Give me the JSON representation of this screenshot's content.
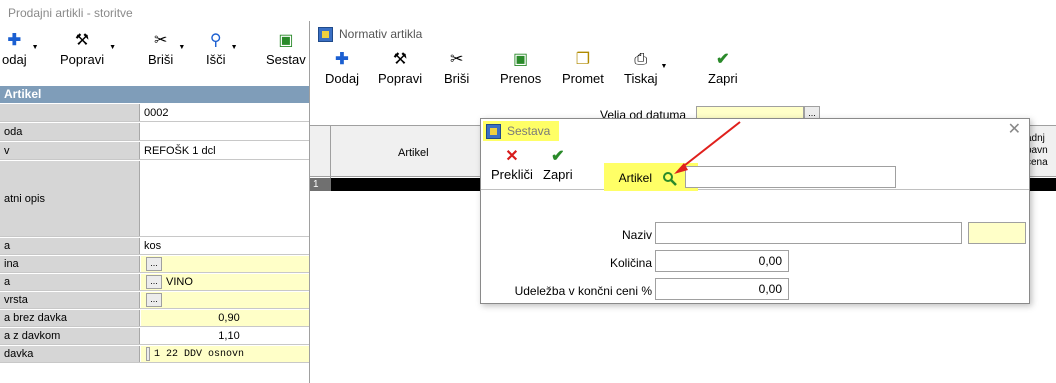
{
  "background_window": {
    "title": "Prodajni artikli - storitve",
    "toolbar": [
      {
        "label": "odaj",
        "icon": "plus-icon"
      },
      {
        "label": "Popravi",
        "icon": "hammer-icon"
      },
      {
        "label": "Briši",
        "icon": "scissors-icon"
      },
      {
        "label": "Išči",
        "icon": "search-icon"
      },
      {
        "label": "Sestav",
        "icon": "assembly-icon"
      }
    ],
    "grid_header": "Artikel",
    "rows": [
      {
        "label": "",
        "value": "0002"
      },
      {
        "label": "oda",
        "value": ""
      },
      {
        "label": "v",
        "value": "REFOŠK 1 dcl"
      },
      {
        "label": "atni opis",
        "value": ""
      },
      {
        "label": "a",
        "value": "kos"
      },
      {
        "label": "ina",
        "value": ""
      },
      {
        "label": "a",
        "value": "VINO"
      },
      {
        "label": "vrsta",
        "value": ""
      },
      {
        "label": "a brez davka",
        "value": "0,90"
      },
      {
        "label": "a z davkom",
        "value": "1,10"
      },
      {
        "label": "davka",
        "value": "1     22  DDV  osnovn"
      }
    ]
  },
  "normativ_window": {
    "title": "Normativ artikla",
    "toolbar": [
      {
        "label": "Dodaj",
        "icon": "plus-icon"
      },
      {
        "label": "Popravi",
        "icon": "hammer-icon"
      },
      {
        "label": "Briši",
        "icon": "scissors-icon"
      },
      {
        "label": "Prenos",
        "icon": "transfer-icon"
      },
      {
        "label": "Promet",
        "icon": "traffic-icon"
      },
      {
        "label": "Tiskaj",
        "icon": "print-icon"
      },
      {
        "label": "Zapri",
        "icon": "check-icon"
      }
    ],
    "velja_label": "Velja od datuma",
    "velja_button": "...",
    "grid_col_artikel": "Artikel",
    "grid_col_right": [
      "adnj",
      "bavn",
      "cena"
    ],
    "row_number": "1"
  },
  "dialog": {
    "title": "Sestava",
    "close": "✕",
    "toolbar": [
      {
        "label": "Prekliči",
        "icon": "x-icon"
      },
      {
        "label": "Zapri",
        "icon": "check-icon"
      }
    ],
    "fields": {
      "artikel_label": "Artikel",
      "artikel_value": "",
      "naziv_label": "Naziv",
      "naziv_value": "",
      "kolicina_label": "Količina",
      "kolicina_value": "0,00",
      "udelezba_label": "Udeležba v končni ceni %",
      "udelezba_value": "0,00"
    }
  },
  "colors": {
    "highlight": "#ffff66",
    "field_yellow": "#ffffc8",
    "arrow": "#e0201c"
  }
}
